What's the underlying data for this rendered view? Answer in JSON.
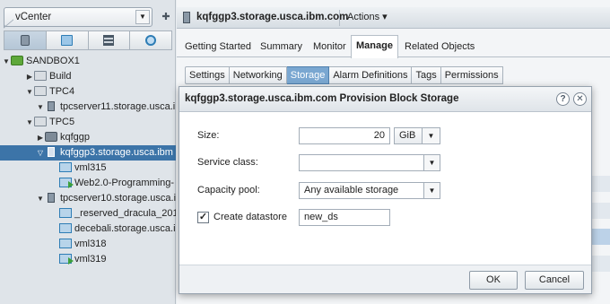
{
  "navigator": {
    "vcenter_label": "vCenter",
    "tree": [
      {
        "label": "SANDBOX1",
        "toggle": "▼",
        "icon": "datacenter-icon"
      },
      {
        "label": "Build",
        "toggle": "▶",
        "icon": "folder-icon"
      },
      {
        "label": "TPC4",
        "toggle": "▼",
        "icon": "folder-icon"
      },
      {
        "label": "tpcserver11.storage.usca.i",
        "toggle": "▼",
        "icon": "host-icon"
      },
      {
        "label": "TPC5",
        "toggle": "▼",
        "icon": "folder-icon"
      },
      {
        "label": "kqfggp",
        "toggle": "▶",
        "icon": "cluster-icon"
      },
      {
        "label": "kqfggp3.storage.usca.ibm",
        "toggle": "▽",
        "icon": "host-icon",
        "selected": true
      },
      {
        "label": "vml315",
        "toggle": "",
        "icon": "vm-icon"
      },
      {
        "label": "Web2.0-Programming-",
        "toggle": "",
        "icon": "vm-powered-on-icon"
      },
      {
        "label": "tpcserver10.storage.usca.i",
        "toggle": "▼",
        "icon": "host-icon"
      },
      {
        "label": "_reserved_dracula_201",
        "toggle": "",
        "icon": "vm-icon"
      },
      {
        "label": "decebali.storage.usca.i",
        "toggle": "",
        "icon": "vm-icon"
      },
      {
        "label": "vml318",
        "toggle": "",
        "icon": "vm-icon"
      },
      {
        "label": "vml319",
        "toggle": "",
        "icon": "vm-powered-on-icon"
      }
    ]
  },
  "header": {
    "title": "kqfggp3.storage.usca.ibm.com",
    "actions_label": "Actions ▾"
  },
  "tabs": [
    "Getting Started",
    "Summary",
    "Monitor",
    "Manage",
    "Related Objects"
  ],
  "active_tab": "Manage",
  "subtabs": [
    "Settings",
    "Networking",
    "Storage",
    "Alarm Definitions",
    "Tags",
    "Permissions"
  ],
  "active_subtab": "Storage",
  "dialog": {
    "title": "kqfggp3.storage.usca.ibm.com Provision Block Storage",
    "size_label": "Size:",
    "size_value": "20",
    "size_unit": "GiB",
    "service_class_label": "Service class:",
    "service_class_value": "",
    "capacity_pool_label": "Capacity pool:",
    "capacity_pool_value": "Any available storage",
    "create_datastore_label": "Create datastore",
    "create_datastore_checked": true,
    "datastore_name": "new_ds",
    "ok_label": "OK",
    "cancel_label": "Cancel"
  },
  "colors": {
    "selection": "#3c74a8",
    "active_subtab": "#7aa7d1"
  }
}
